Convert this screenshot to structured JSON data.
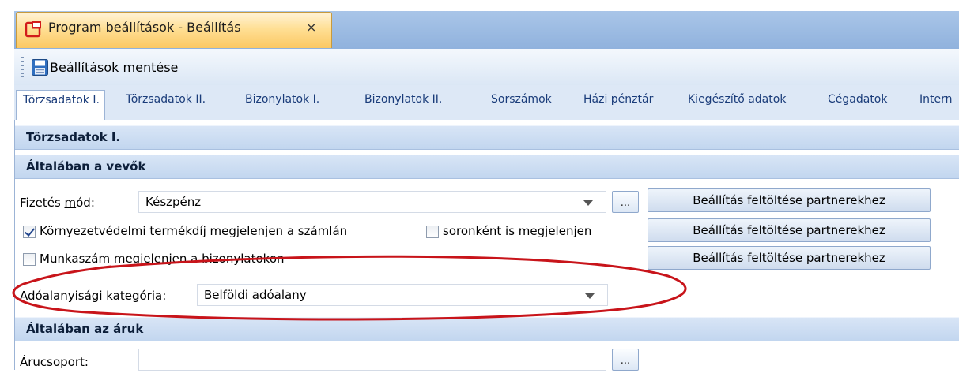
{
  "window": {
    "title": "Program beállítások - Beállítás",
    "close_glyph": "×"
  },
  "toolbar": {
    "save_label": "Beállítások mentése"
  },
  "tabs": [
    {
      "label": "Törzsadatok I."
    },
    {
      "label": "Törzsadatok II."
    },
    {
      "label": "Bizonylatok I."
    },
    {
      "label": "Bizonylatok II."
    },
    {
      "label": "Sorszámok"
    },
    {
      "label": "Házi pénztár"
    },
    {
      "label": "Kiegészítő adatok"
    },
    {
      "label": "Cégadatok"
    },
    {
      "label": "Intern"
    }
  ],
  "page": {
    "title": "Törzsadatok I."
  },
  "groups": {
    "customers": {
      "title": "Általában a vevők",
      "payment": {
        "label_pre": "Fizetés ",
        "label_mnemonic": "m",
        "label_post": "ód:",
        "value": "Készpénz",
        "ellipsis": "..."
      },
      "env_fee": {
        "label": "Környezetvédelmi termékdíj megjelenjen a számlán",
        "checked": true
      },
      "per_row": {
        "label": "soronként is megjelenjen",
        "checked": false
      },
      "worknumber": {
        "label": "Munkaszám megjelenjen a bizonylatokon",
        "checked": false
      },
      "fill_buttons": [
        {
          "label": "Beállítás feltöltése partnerekhez"
        },
        {
          "label": "Beállítás feltöltése partnerekhez"
        },
        {
          "label": "Beállítás feltöltése partnerekhez"
        }
      ],
      "tax_category": {
        "label": "Adóalanyisági kategória:",
        "value": "Belföldi adóalany"
      }
    },
    "products": {
      "title": "Általában az áruk",
      "product_group": {
        "label": "Árucsoport:",
        "value": "",
        "ellipsis": "..."
      }
    }
  },
  "colors": {
    "highlight_ellipse": "#c8141a",
    "active_tab": "#fbc862",
    "header_gradient_top": "#d8e5f6"
  },
  "icons": {
    "doc": "settings-window-icon",
    "save": "floppy-disk-icon",
    "close": "close-icon"
  }
}
